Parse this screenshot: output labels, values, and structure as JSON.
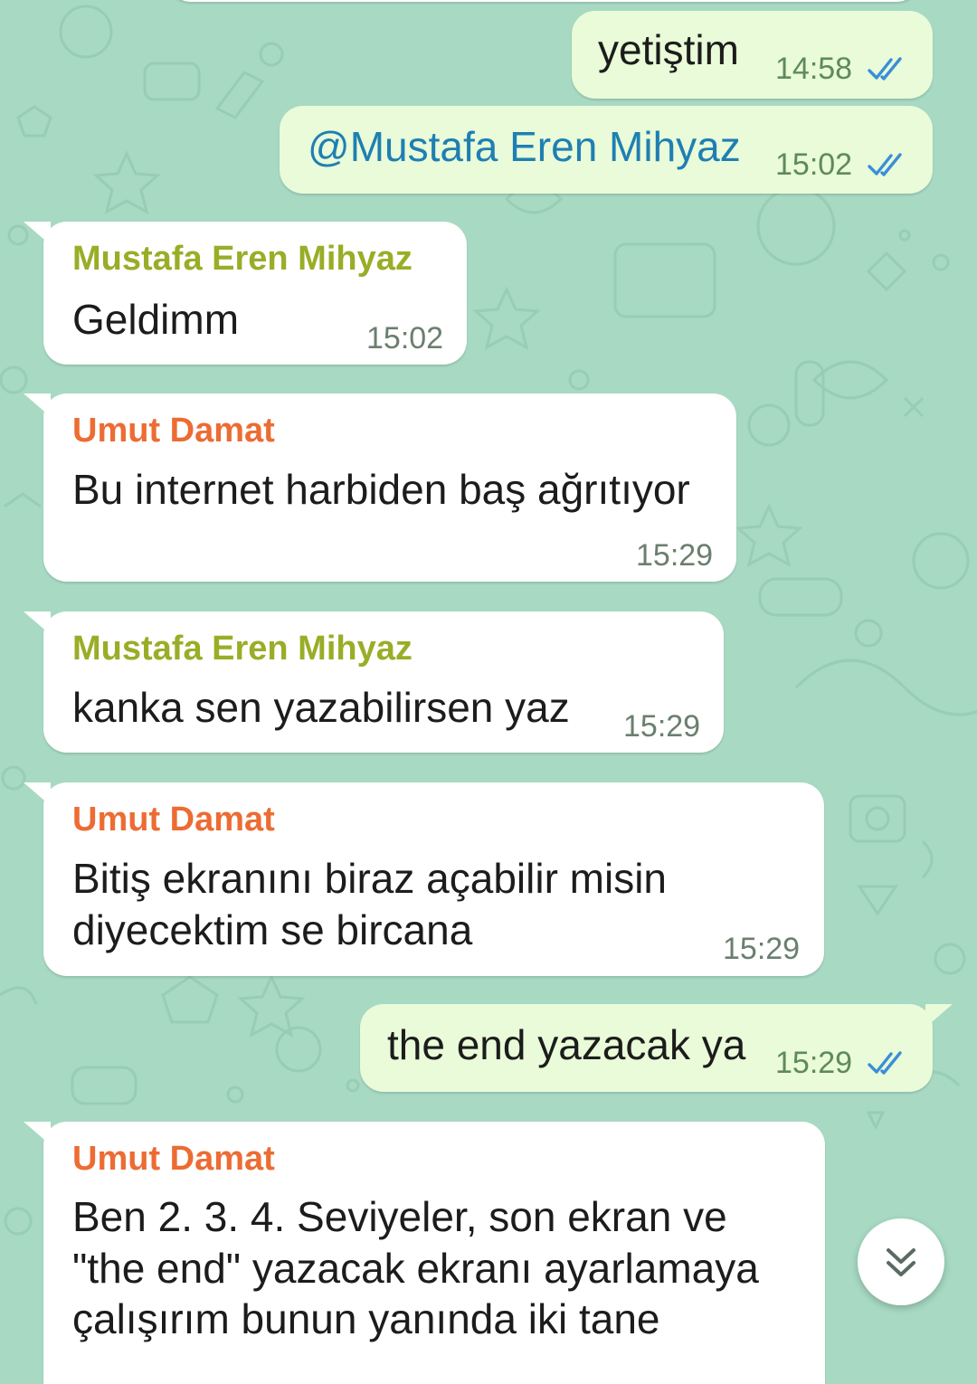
{
  "theme": {
    "wallpaper": "#a7d9c3",
    "incoming_bubble": "#ffffff",
    "outgoing_bubble": "#e9fbd8",
    "mention_color": "#1f7fb3",
    "sender_mustafa_color": "#9aad27",
    "sender_umut_color": "#ec6c33",
    "read_ticks_color": "#3a8fd6"
  },
  "messages": [
    {
      "direction": "out",
      "text": "yetiştim",
      "time": "14:58",
      "status": "read",
      "status_icon": "double-check-icon"
    },
    {
      "direction": "out",
      "text": "@Mustafa Eren Mihyaz",
      "time": "15:02",
      "status": "read",
      "status_icon": "double-check-icon"
    },
    {
      "direction": "in",
      "sender": "Mustafa Eren Mihyaz",
      "text": "Geldimm",
      "time": "15:02"
    },
    {
      "direction": "in",
      "sender": "Umut Damat",
      "text": "Bu internet harbiden baş ağrıtıyor",
      "time": "15:29"
    },
    {
      "direction": "in",
      "sender": "Mustafa Eren Mihyaz",
      "text": "kanka sen yazabilirsen yaz",
      "time": "15:29"
    },
    {
      "direction": "in",
      "sender": "Umut Damat",
      "text_lines": [
        "Bitiş ekranını biraz açabilir misin",
        "diyecektim se bircana"
      ],
      "time": "15:29"
    },
    {
      "direction": "out",
      "text": "the end yazacak ya",
      "time": "15:29",
      "status": "read",
      "status_icon": "double-check-icon"
    },
    {
      "direction": "in",
      "sender": "Umut Damat",
      "text_lines": [
        "Ben 2. 3. 4. Seviyeler, son ekran ve",
        "\"the end\" yazacak ekranı ayarlamaya",
        "çalışırım bunun yanında iki tane"
      ]
    }
  ],
  "scroll_button": {
    "icon": "double-chevron-down-icon"
  }
}
